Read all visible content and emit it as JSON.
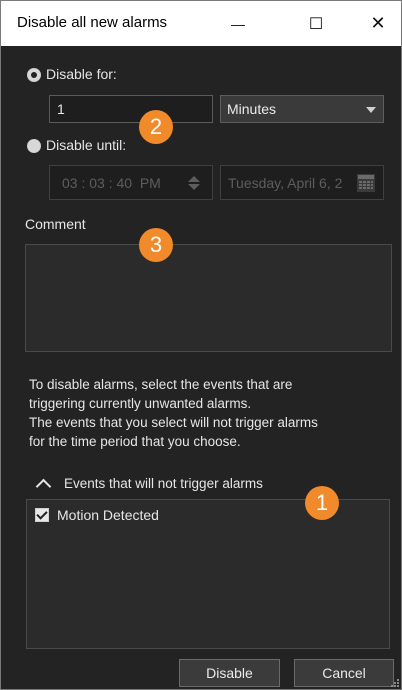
{
  "window": {
    "title": "Disable all new alarms",
    "minimize_glyph": "—",
    "maximize_glyph": "☐",
    "close_glyph": "✕"
  },
  "disable_for": {
    "label": "Disable for:",
    "selected": true,
    "amount": "1",
    "unit_selected": "Minutes"
  },
  "disable_until": {
    "label": "Disable until:",
    "selected": false,
    "time": "03 : 03 : 40  PM",
    "date": "Tuesday, April 6, 2"
  },
  "comment": {
    "label": "Comment",
    "value": ""
  },
  "info_text": [
    "To disable alarms, select the events that are",
    "triggering currently unwanted alarms.",
    "The events that you select will not trigger alarms",
    "for the time period that you choose."
  ],
  "events": {
    "header": "Events that will not trigger alarms",
    "items": [
      {
        "label": "Motion Detected",
        "checked": true
      }
    ]
  },
  "buttons": {
    "disable": "Disable",
    "cancel": "Cancel"
  },
  "callouts": {
    "one": "1",
    "two": "2",
    "three": "3",
    "color": "#f08a2a"
  },
  "colors": {
    "background": "#232323",
    "text": "#e6e6e6"
  }
}
